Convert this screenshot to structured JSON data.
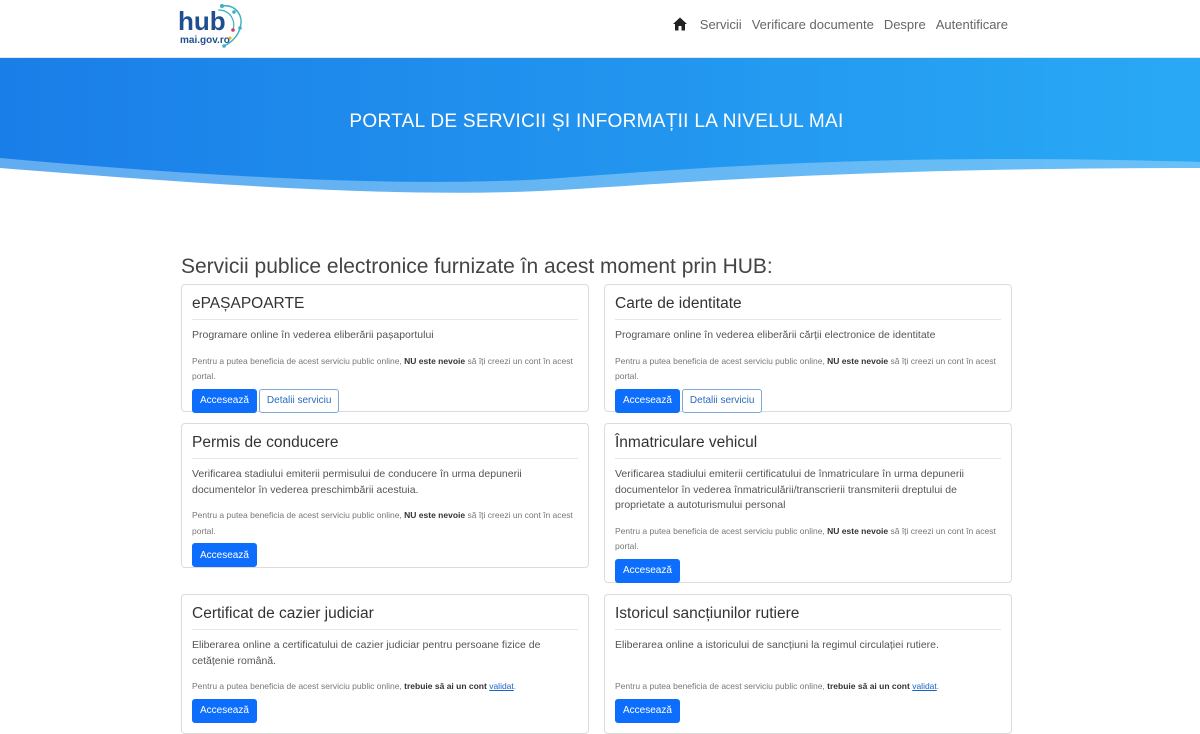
{
  "header": {
    "logo_text_main": "hub",
    "logo_text_sub": "mai.gov.ro",
    "nav": [
      "Servicii",
      "Verificare documente",
      "Despre",
      "Autentificare"
    ]
  },
  "hero": {
    "title": "PORTAL DE SERVICII ȘI INFORMAȚII LA NIVELUL MAI"
  },
  "section": {
    "title": "Servicii publice electronice furnizate în acest moment prin HUB:"
  },
  "note": {
    "prefix": "Pentru a putea beneficia de acest serviciu public online, ",
    "no_account_bold": "NU este nevoie",
    "no_account_suffix": " să îți creezi un cont în acest portal.",
    "account_bold": "trebuie să ai un cont",
    "account_link": "validat",
    "account_suffix": "."
  },
  "buttons": {
    "access": "Accesează",
    "details": "Detalii serviciu"
  },
  "cards": [
    {
      "title": "ePAȘAPOARTE",
      "desc": "Programare online în vederea eliberării pașaportului"
    },
    {
      "title": "Carte de identitate",
      "desc": "Programare online în vederea eliberării cărții electronice de identitate"
    },
    {
      "title": "Permis de conducere",
      "desc": "Verificarea stadiului emiterii permisului de conducere în urma depunerii documentelor în vederea preschimbării acestuia."
    },
    {
      "title": "Înmatriculare vehicul",
      "desc": "Verificarea stadiului emiterii certificatului de înmatriculare în urma depunerii documentelor în vederea înmatriculării/transcrierii transmiterii dreptului de proprietate a autoturismului personal"
    },
    {
      "title": "Certificat de cazier judiciar",
      "desc": "Eliberarea online a certificatului de cazier judiciar pentru persoane fizice de cetățenie română."
    },
    {
      "title": "Istoricul sancțiunilor rutiere",
      "desc": "Eliberarea online a istoricului de sancțiuni la regimul circulației rutiere."
    }
  ],
  "colors": {
    "primary": "#0d6efd",
    "hero_start": "#1a7ee8",
    "hero_end": "#29a9f5"
  }
}
